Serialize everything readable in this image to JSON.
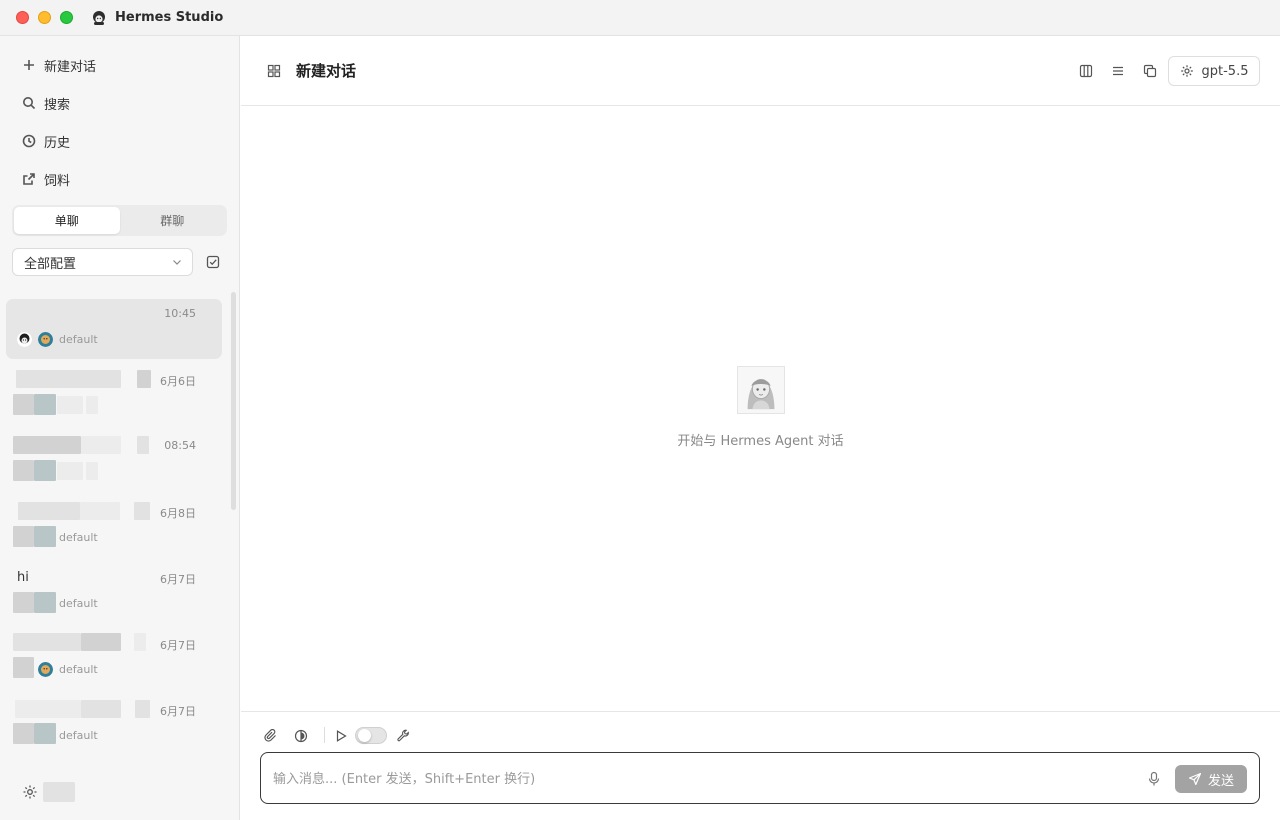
{
  "app": {
    "title": "Hermes Studio"
  },
  "sidebar": {
    "nav": [
      {
        "label": "新建对话",
        "icon": "plus-icon"
      },
      {
        "label": "搜索",
        "icon": "search-icon"
      },
      {
        "label": "历史",
        "icon": "clock-icon"
      },
      {
        "label": "饲料",
        "icon": "external-link-icon"
      }
    ],
    "tabs": [
      {
        "label": "单聊",
        "active": true
      },
      {
        "label": "群聊",
        "active": false
      }
    ],
    "filter": {
      "value": "全部配置"
    },
    "conversations": [
      {
        "title": "",
        "time": "10:45",
        "subtitle": "default",
        "selected": true
      },
      {
        "title": "",
        "time": "6月6日",
        "subtitle": ""
      },
      {
        "title": "",
        "time": "08:54",
        "subtitle": ""
      },
      {
        "title": "",
        "time": "6月8日",
        "subtitle": "default"
      },
      {
        "title": "hi",
        "time": "6月7日",
        "subtitle": "default"
      },
      {
        "title": "",
        "time": "6月7日",
        "subtitle": "default"
      },
      {
        "title": "",
        "time": "6月7日",
        "subtitle": "default"
      }
    ]
  },
  "main": {
    "title": "新建对话",
    "model": "gpt-5.5",
    "empty_text": "开始与 Hermes Agent 对话"
  },
  "composer": {
    "placeholder": "输入消息... (Enter 发送，Shift+Enter 换行)",
    "send_label": "发送"
  },
  "colors": {
    "accent_send": "#a3a3a3",
    "sidebar_bg": "#f6f6f6",
    "selected_row": "#e6e6e6"
  }
}
